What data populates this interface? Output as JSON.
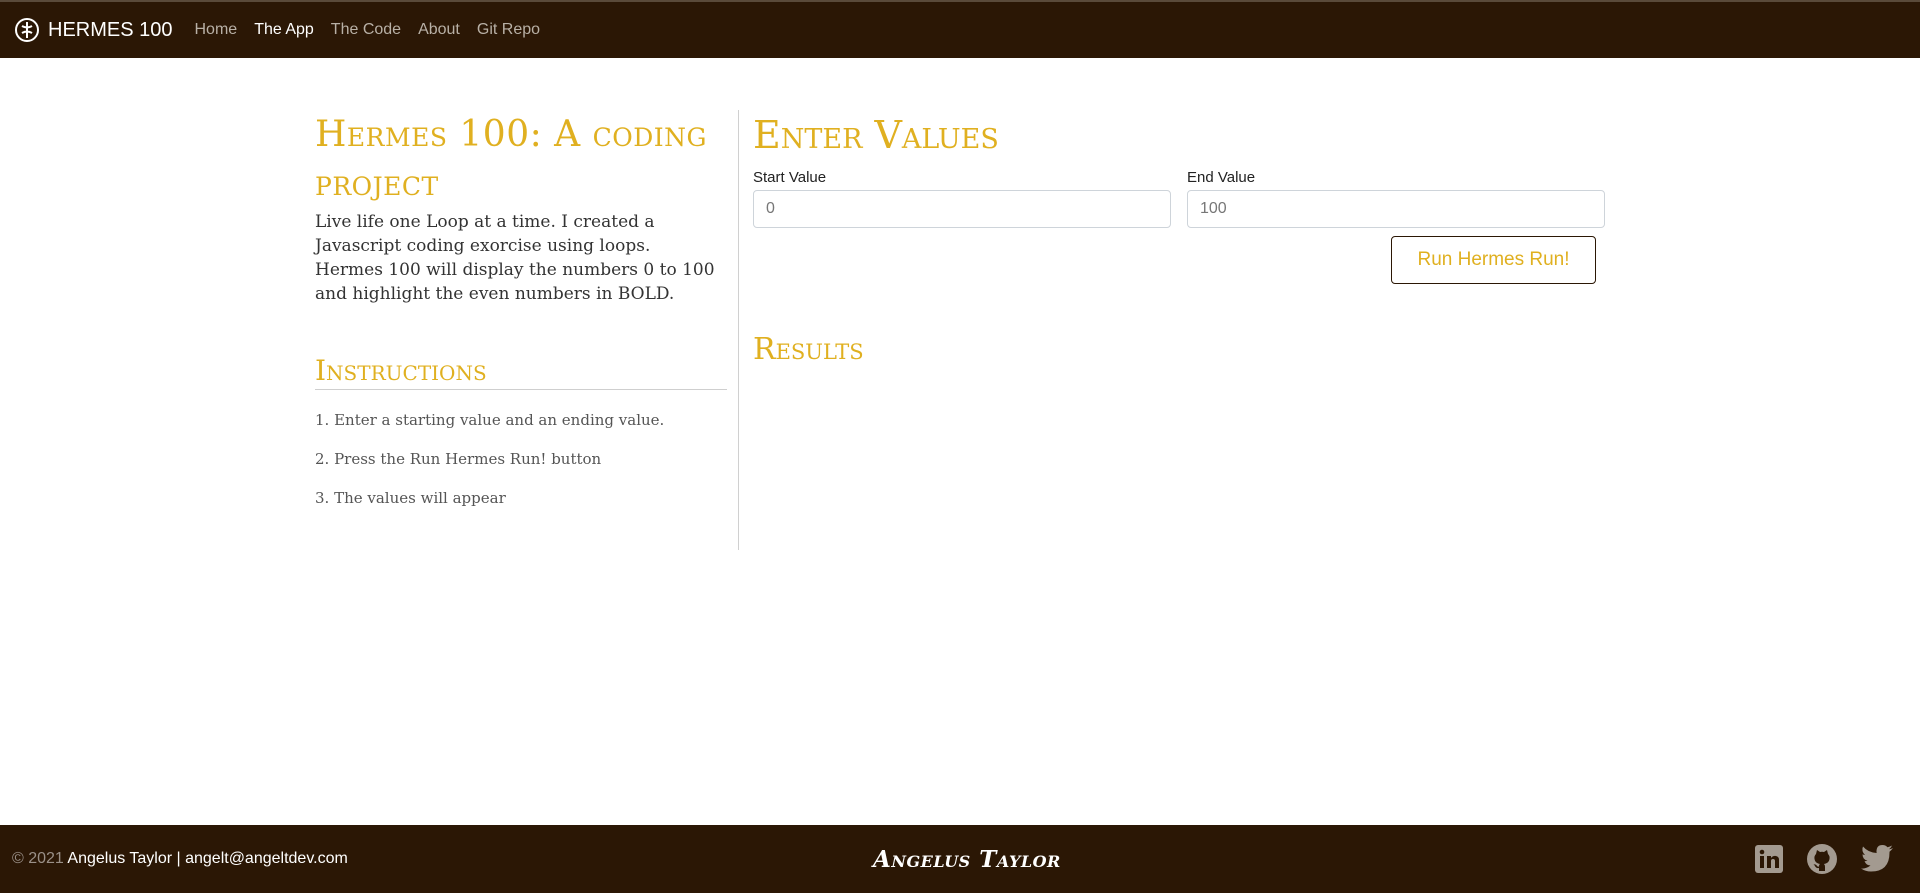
{
  "nav": {
    "brand": "HERMES 100",
    "links": [
      "Home",
      "The App",
      "The Code",
      "About",
      "Git Repo"
    ]
  },
  "left": {
    "title": "Hermes 100: A coding project",
    "intro": "Live life one Loop at a time. I created a Javascript coding exorcise using loops. Hermes 100 will display the numbers 0 to 100 and highlight the even numbers in BOLD.",
    "instructions_title": "Instructions",
    "steps": [
      "1. Enter a starting value and an ending value.",
      "2. Press the Run Hermes Run! button",
      "3. The values will appear"
    ]
  },
  "right": {
    "title": "Enter Values",
    "start_label": "Start Value",
    "start_value": "0",
    "end_label": "End Value",
    "end_value": "100",
    "run_button": "Run Hermes Run!",
    "results_title": "Results"
  },
  "footer": {
    "copyright": "© 2021",
    "name": "Angelus Taylor | angelt@angeltdev.com",
    "center": "Angelus Taylor",
    "icons": [
      "linkedin-icon",
      "github-icon",
      "twitter-icon"
    ]
  },
  "colors": {
    "dark_brown": "#2b1705",
    "gold": "#e0b020"
  }
}
